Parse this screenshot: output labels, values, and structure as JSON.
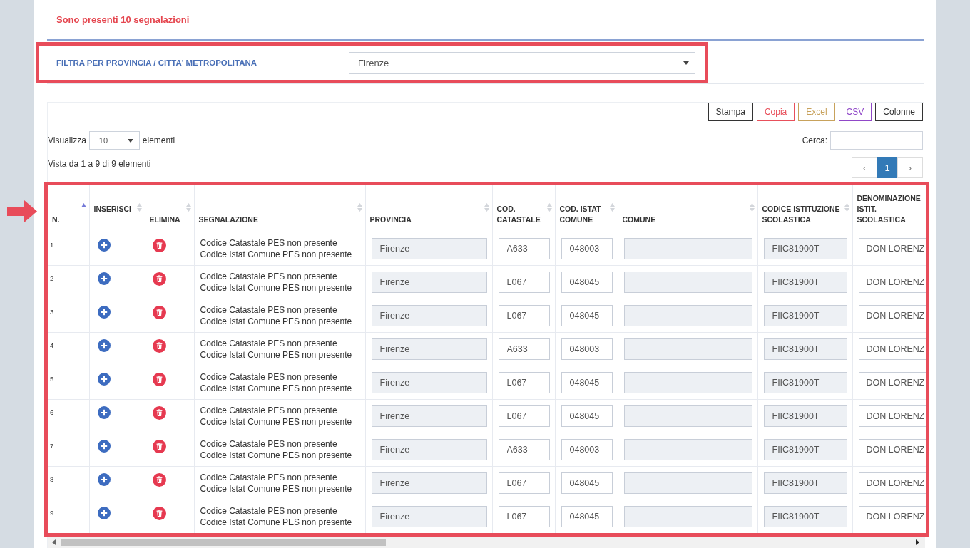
{
  "page_title": "Sono presenti 10 segnalazioni",
  "filter": {
    "label": "FILTRA PER PROVINCIA / CITTA' METROPOLITANA",
    "value": "Firenze",
    "highlighted": true
  },
  "toolbar": {
    "buttons": [
      {
        "label": "Stampa",
        "color": "#333333"
      },
      {
        "label": "Copia",
        "color": "#e8505b"
      },
      {
        "label": "Excel",
        "color": "#c8a25c"
      },
      {
        "label": "CSV",
        "color": "#9048c8"
      },
      {
        "label": "Colonne",
        "color": "#333333"
      }
    ]
  },
  "length_menu": {
    "label": "Visualizza",
    "value": "10",
    "suffix": "elementi"
  },
  "search": {
    "label": "Cerca:"
  },
  "info": "Vista da 1 a 9 di 9 elementi",
  "pagination": [
    {
      "label": "‹",
      "selected": false
    },
    {
      "label": "1",
      "selected": true
    },
    {
      "label": "›",
      "selected": false
    }
  ],
  "table": {
    "highlighted": true,
    "columns": [
      {
        "kind": "index",
        "label": [
          "N."
        ],
        "sorted": true
      },
      {
        "kind": "add",
        "label": [
          "INSERISCI"
        ],
        "sorted": false
      },
      {
        "kind": "delete",
        "label": [
          "ELIMINA"
        ],
        "sorted": false
      },
      {
        "kind": "message",
        "label": [
          "SEGNALAZIONE"
        ],
        "sorted": false
      },
      {
        "kind": "field",
        "label": [
          "PROVINCIA"
        ],
        "sorted": false,
        "readonly": true
      },
      {
        "kind": "field",
        "label": [
          "COD.",
          "CATASTALE"
        ],
        "sorted": false,
        "readonly": false
      },
      {
        "kind": "field",
        "label": [
          "COD. ISTAT",
          "COMUNE"
        ],
        "sorted": false,
        "readonly": false
      },
      {
        "kind": "field",
        "label": [
          "COMUNE"
        ],
        "sorted": false,
        "readonly": true
      },
      {
        "kind": "field",
        "label": [
          "CODICE ISTITUZIONE",
          "SCOLASTICA"
        ],
        "sorted": false,
        "readonly": true
      },
      {
        "kind": "field",
        "label": [
          "DENOMINAZIONE",
          "ISTIT.",
          "SCOLASTICA"
        ],
        "readonly": false
      }
    ],
    "rows": [
      {
        "number": "1",
        "messages": [
          "Codice Catastale PES non presente",
          "Codice Istat Comune PES non presente"
        ],
        "provincia": "Firenze",
        "cod_catastale": "A633",
        "cod_istat_comune": "048003",
        "codice_istituzione": "FIIC81900T",
        "denominazione": "DON LORENZ"
      },
      {
        "number": "2",
        "messages": [
          "Codice Catastale PES non presente",
          "Codice Istat Comune PES non presente"
        ],
        "provincia": "Firenze",
        "cod_catastale": "L067",
        "cod_istat_comune": "048045",
        "codice_istituzione": "FIIC81900T",
        "denominazione": "DON LORENZ"
      },
      {
        "number": "3",
        "messages": [
          "Codice Catastale PES non presente",
          "Codice Istat Comune PES non presente"
        ],
        "provincia": "Firenze",
        "cod_catastale": "L067",
        "cod_istat_comune": "048045",
        "codice_istituzione": "FIIC81900T",
        "denominazione": "DON LORENZ"
      },
      {
        "number": "4",
        "messages": [
          "Codice Catastale PES non presente",
          "Codice Istat Comune PES non presente"
        ],
        "provincia": "Firenze",
        "cod_catastale": "A633",
        "cod_istat_comune": "048003",
        "codice_istituzione": "FIIC81900T",
        "denominazione": "DON LORENZ"
      },
      {
        "number": "5",
        "messages": [
          "Codice Catastale PES non presente",
          "Codice Istat Comune PES non presente"
        ],
        "provincia": "Firenze",
        "cod_catastale": "L067",
        "cod_istat_comune": "048045",
        "codice_istituzione": "FIIC81900T",
        "denominazione": "DON LORENZ"
      },
      {
        "number": "6",
        "messages": [
          "Codice Catastale PES non presente",
          "Codice Istat Comune PES non presente"
        ],
        "provincia": "Firenze",
        "cod_catastale": "L067",
        "cod_istat_comune": "048045",
        "codice_istituzione": "FIIC81900T",
        "denominazione": "DON LORENZ"
      },
      {
        "number": "7",
        "messages": [
          "Codice Catastale PES non presente",
          "Codice Istat Comune PES non presente"
        ],
        "provincia": "Firenze",
        "cod_catastale": "A633",
        "cod_istat_comune": "048003",
        "codice_istituzione": "FIIC81900T",
        "denominazione": "DON LORENZ"
      },
      {
        "number": "8",
        "messages": [
          "Codice Catastale PES non presente",
          "Codice Istat Comune PES non presente"
        ],
        "provincia": "Firenze",
        "cod_catastale": "L067",
        "cod_istat_comune": "048045",
        "codice_istituzione": "FIIC81900T",
        "denominazione": "DON LORENZ"
      },
      {
        "number": "9",
        "messages": [
          "Codice Catastale PES non presente",
          "Codice Istat Comune PES non presente"
        ],
        "provincia": "Firenze",
        "cod_catastale": "L067",
        "cod_istat_comune": "048045",
        "codice_istituzione": "FIIC81900T",
        "denominazione": "DON LORENZ"
      }
    ]
  }
}
